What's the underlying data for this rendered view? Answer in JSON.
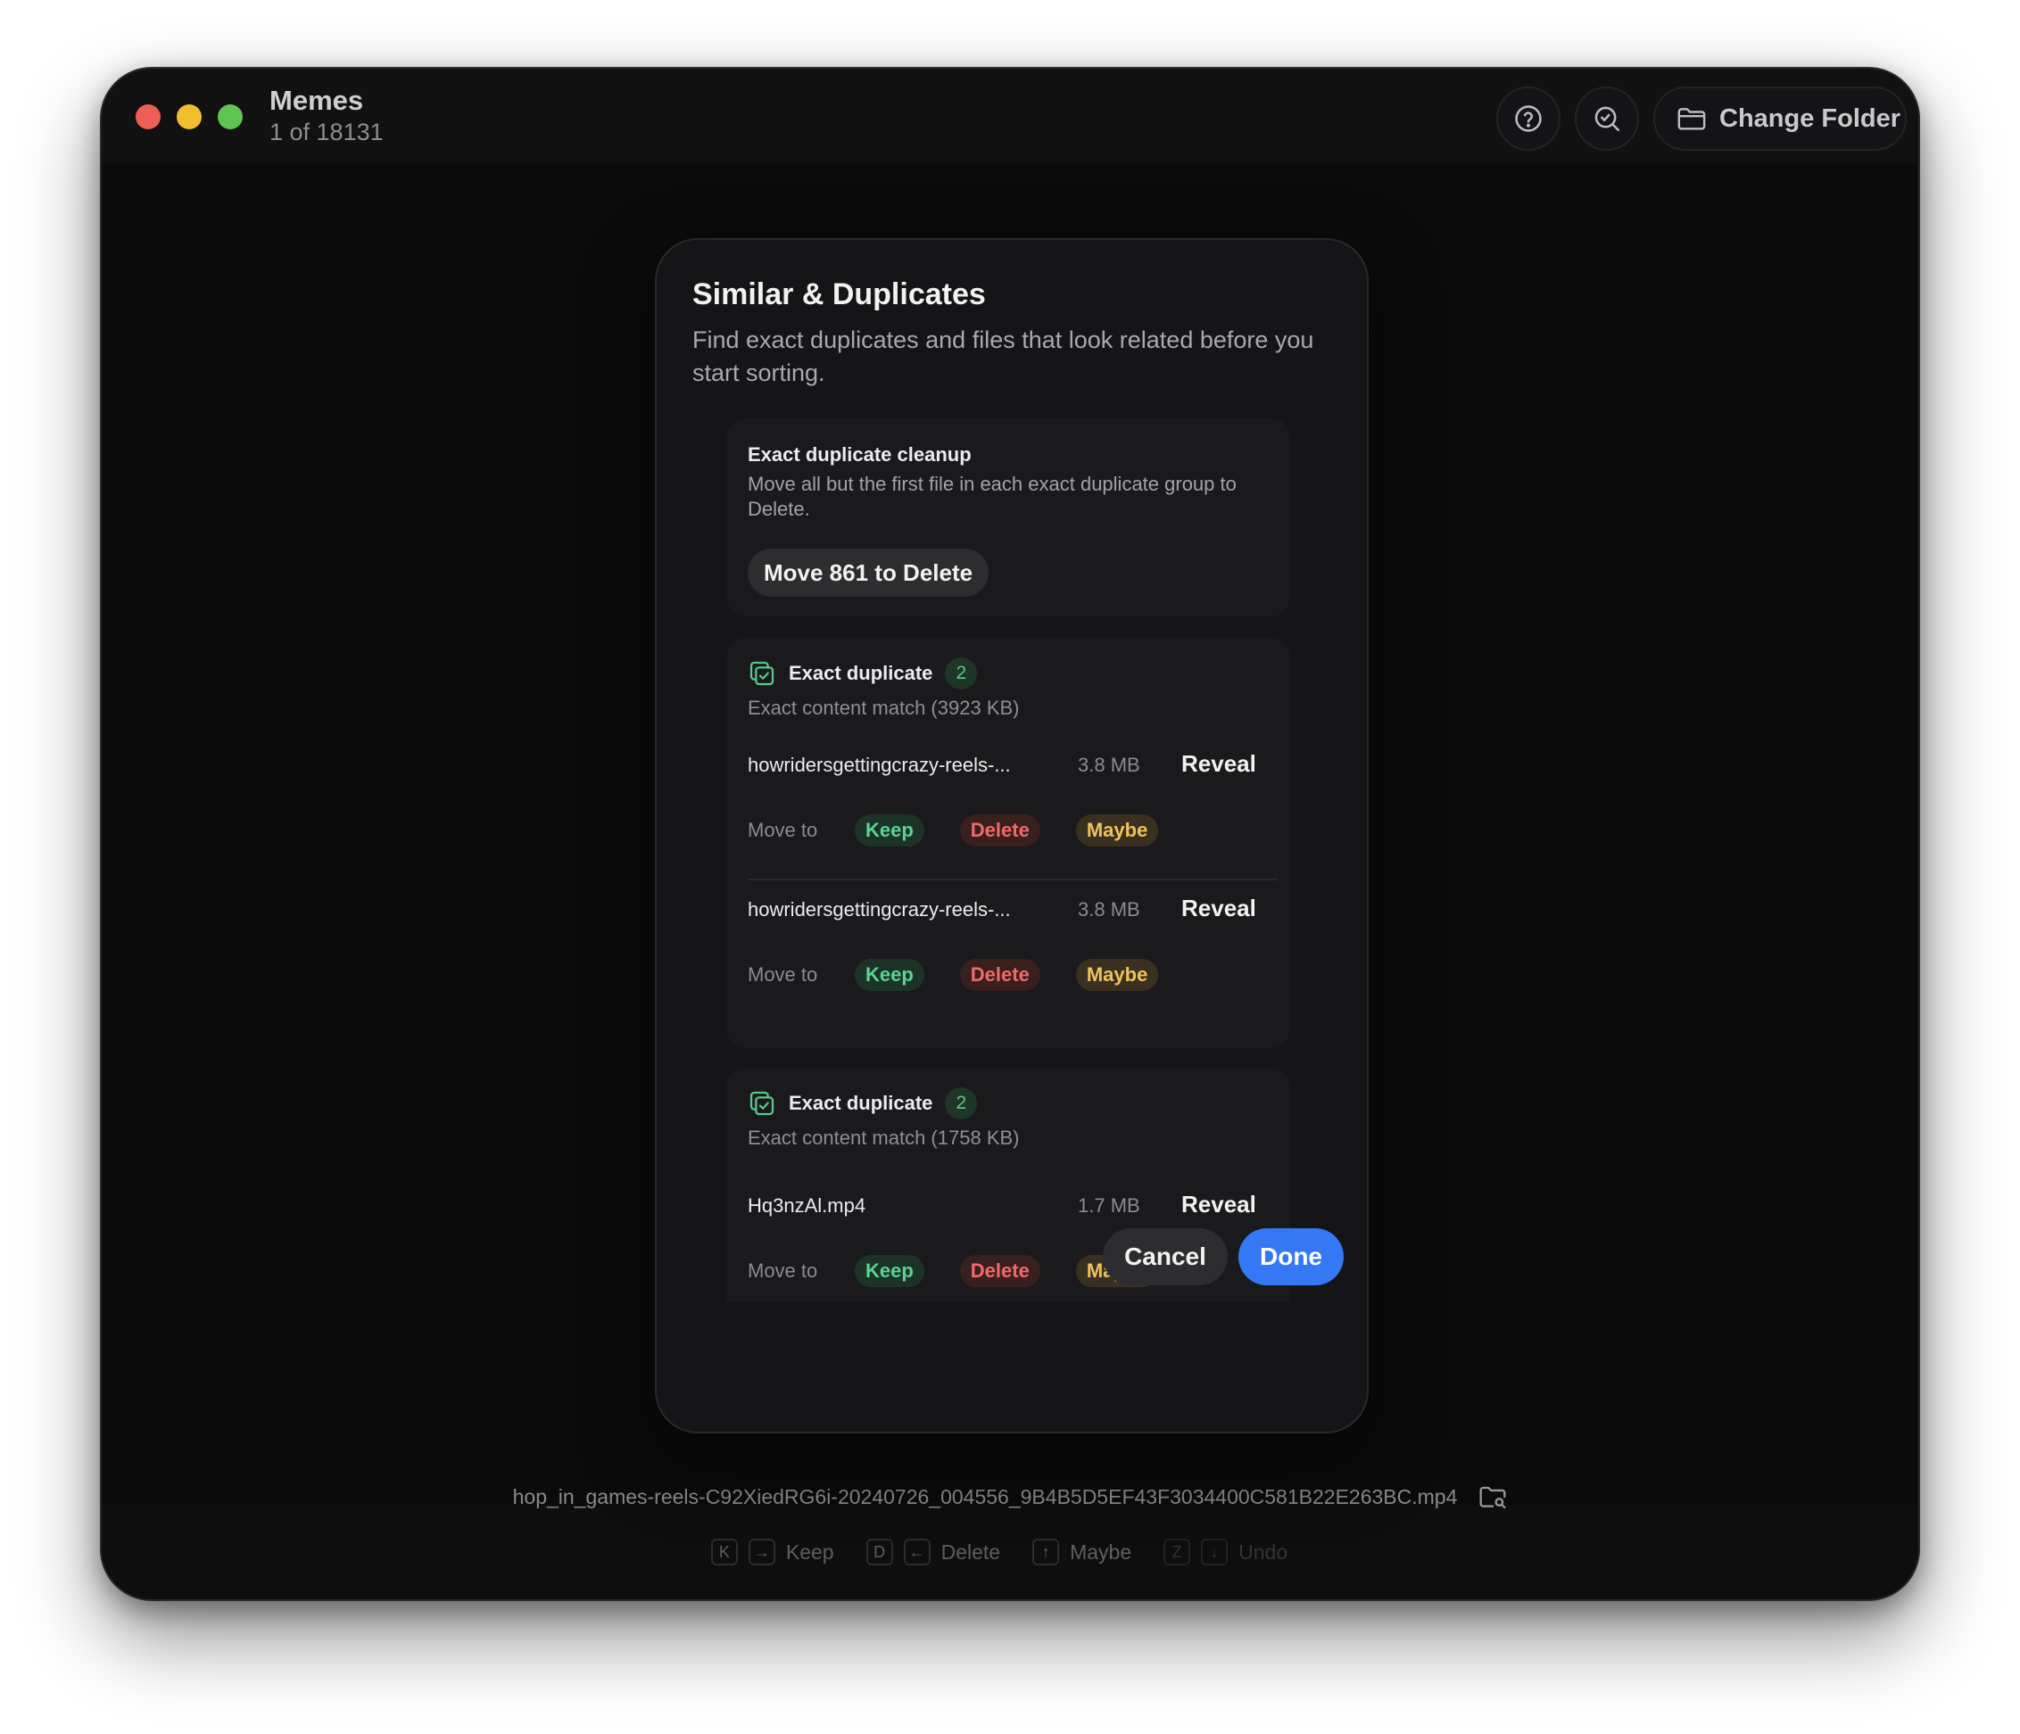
{
  "window": {
    "app_title": "Memes",
    "position_text": "1 of 18131",
    "change_folder_label": "Change Folder"
  },
  "footer": {
    "filename": "hop_in_games-reels-C92XiedRG6i-20240726_004556_9B4B5D5EF43F3034400C581B22E263BC.mp4",
    "shortcuts": [
      {
        "key": "K",
        "arrow": "→",
        "label": "Keep"
      },
      {
        "key": "D",
        "arrow": "←",
        "label": "Delete"
      },
      {
        "arrow": "↑",
        "label": "Maybe"
      },
      {
        "key": "Z",
        "arrow": "↓",
        "label": "Undo"
      }
    ]
  },
  "modal": {
    "title": "Similar & Duplicates",
    "description": "Find exact duplicates and files that look related before you start sorting.",
    "cleanup": {
      "title": "Exact duplicate cleanup",
      "text": "Move all but the first file in each exact duplicate group to Delete.",
      "button": "Move 861 to Delete"
    },
    "move_to_label": "Move to",
    "actions": {
      "keep": "Keep",
      "delete": "Delete",
      "maybe": "Maybe",
      "reveal": "Reveal"
    },
    "groups": [
      {
        "title": "Exact duplicate",
        "count": "2",
        "subtitle": "Exact content match (3923 KB)",
        "files": [
          {
            "name": "howridersgettingcrazy-reels-...",
            "size": "3.8 MB"
          },
          {
            "name": "howridersgettingcrazy-reels-...",
            "size": "3.8 MB"
          }
        ]
      },
      {
        "title": "Exact duplicate",
        "count": "2",
        "subtitle": "Exact content match (1758 KB)",
        "files": [
          {
            "name": "Hq3nzAl.mp4",
            "size": "1.7 MB"
          }
        ]
      }
    ],
    "cancel_label": "Cancel",
    "done_label": "Done"
  },
  "colors": {
    "accent": "#3478f6",
    "keep": "#5bd38f",
    "delete": "#f06a6a",
    "maybe": "#f1c15c"
  },
  "icons": [
    "help-icon",
    "search-scan-icon",
    "folder-icon",
    "duplicate-icon",
    "reveal-folder-icon"
  ]
}
